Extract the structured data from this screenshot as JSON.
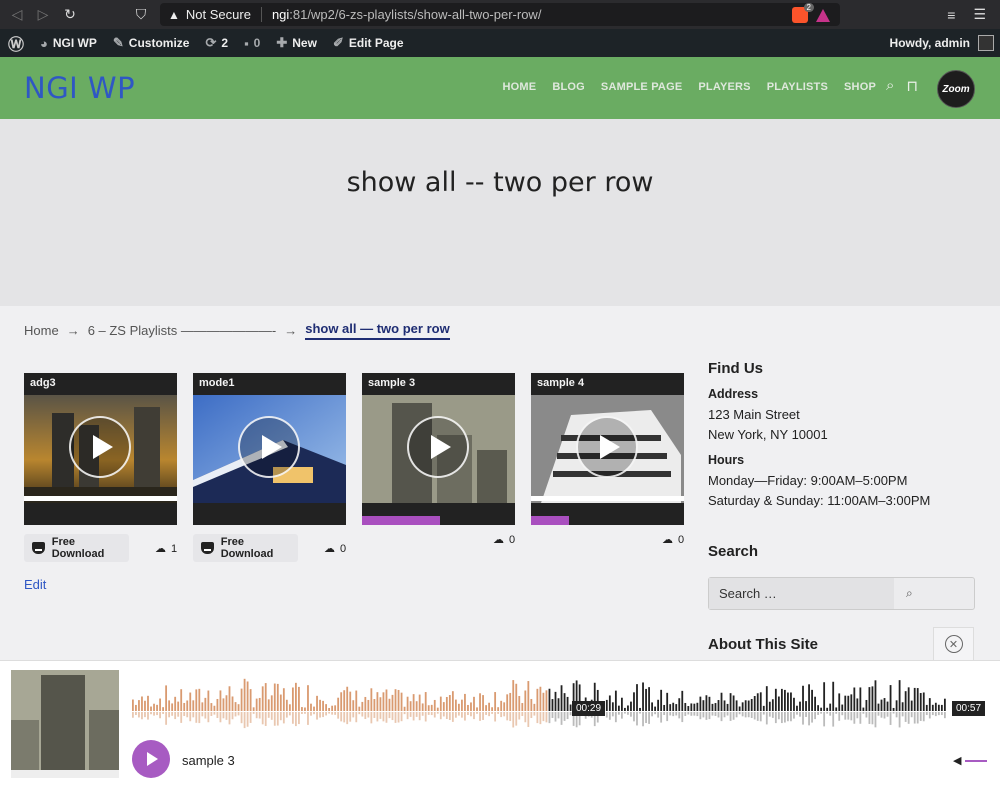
{
  "browser": {
    "security_label": "Not Secure",
    "url_host": "ngi",
    "url_path": ":81/wp2/6-zs-playlists/show-all-two-per-row/",
    "brave_badge": "2"
  },
  "admin_bar": {
    "site_name": "NGI WP",
    "customize": "Customize",
    "updates_count": "2",
    "comments_count": "0",
    "new": "New",
    "edit_page": "Edit Page",
    "howdy": "Howdy, admin"
  },
  "site": {
    "title": "NGI WP",
    "logo_text": "Zoom",
    "nav": [
      "HOME",
      "BLOG",
      "SAMPLE PAGE",
      "PLAYERS",
      "PLAYLISTS",
      "SHOP"
    ]
  },
  "hero": {
    "title": "show all -- two per row"
  },
  "breadcrumb": {
    "home": "Home",
    "parent": "6 – ZS Playlists ———————-",
    "current": "show all — two per row",
    "arrow": "→"
  },
  "cards": [
    {
      "title": "adg3",
      "download_label": "Free Download",
      "count": "1"
    },
    {
      "title": "mode1",
      "download_label": "Free Download",
      "count": "0"
    },
    {
      "title": "sample 3",
      "count": "0"
    },
    {
      "title": "sample 4",
      "count": "0"
    }
  ],
  "edit_link": "Edit",
  "sidebar": {
    "find_us": "Find Us",
    "address_label": "Address",
    "address_line1": "123 Main Street",
    "address_line2": "New York, NY 10001",
    "hours_label": "Hours",
    "hours_line1": "Monday—Friday: 9:00AM–5:00PM",
    "hours_line2": "Saturday & Sunday: 11:00AM–3:00PM",
    "search_title": "Search",
    "search_placeholder": "Search …",
    "about_title": "About This Site"
  },
  "player": {
    "current_time": "00:29",
    "total_time": "00:57",
    "progress": 0.51,
    "track_title": "sample 3",
    "played_color": "#d99a70",
    "unplayed_color": "#222222",
    "accent": "#a75bc2"
  }
}
